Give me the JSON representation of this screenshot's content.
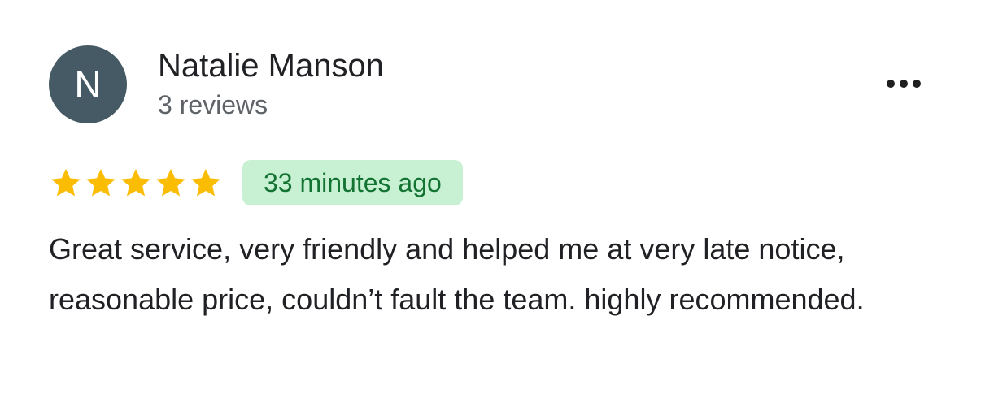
{
  "review": {
    "avatar_letter": "N",
    "author_name": "Natalie Manson",
    "author_meta": "3 reviews",
    "rating": 5,
    "rating_max": 5,
    "time_ago": "33 minutes ago",
    "text": "Great service, very friendly and helped me at very late notice, reasonable price, couldn’t fault the team. highly recommended."
  },
  "icons": {
    "star": "star-icon",
    "more": "more-options-icon"
  },
  "colors": {
    "avatar_bg": "#455a64",
    "star": "#fbbc04",
    "badge_bg": "#c8f0d2",
    "badge_text": "#137333"
  }
}
